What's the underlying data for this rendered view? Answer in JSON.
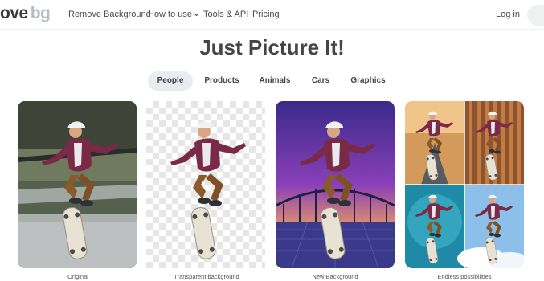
{
  "nav": {
    "logo_text": "ove",
    "logo_suffix": "bg",
    "links": [
      "Remove Background",
      "How to use",
      "Tools & API",
      "Pricing"
    ],
    "login": "Log in"
  },
  "heading": "Just Picture It!",
  "tabs": [
    {
      "label": "People",
      "active": true
    },
    {
      "label": "Products",
      "active": false
    },
    {
      "label": "Animals",
      "active": false
    },
    {
      "label": "Cars",
      "active": false
    },
    {
      "label": "Graphics",
      "active": false
    }
  ],
  "examples": [
    {
      "caption": "Original",
      "background": "skatepark photo"
    },
    {
      "caption": "Transparent background",
      "background": "transparent checkerboard"
    },
    {
      "caption": "New Background",
      "background": "purple sunset city"
    },
    {
      "caption": "Endless possibilities",
      "background": "four-panel collage"
    }
  ],
  "colors": {
    "active_tab_bg": "#e9edf1",
    "text": "#454545",
    "shirt": "#7a2a46",
    "pants": "#8a5a2a"
  }
}
